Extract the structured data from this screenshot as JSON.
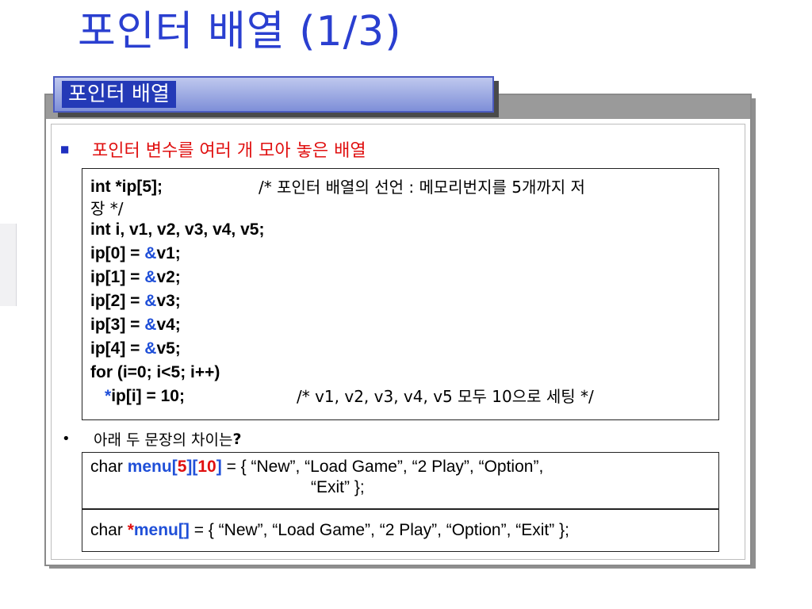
{
  "title": "포인터 배열 (1/3)",
  "header_tab": "포인터 배열",
  "bullet1": "포인터 변수를 여러 개 모아 놓은 배열",
  "bullet2": {
    "text": "아래 두 문장의 차이는",
    "q": "?"
  },
  "code": {
    "l1_code": "int *ip[5];",
    "l1_comment": "/* 포인터 배열의 선언 : 메모리번지를 5개까지 저",
    "l1_wrap": "장 */",
    "l2": "int i, v1, v2, v3, v4, v5;",
    "assign": [
      {
        "lhs": "ip[0] = ",
        "amp": "&",
        "rhs": "v1;"
      },
      {
        "lhs": "ip[1] = ",
        "amp": "&",
        "rhs": "v2;"
      },
      {
        "lhs": "ip[2] = ",
        "amp": "&",
        "rhs": "v3;"
      },
      {
        "lhs": "ip[3] = ",
        "amp": "&",
        "rhs": "v4;"
      },
      {
        "lhs": "ip[4] = ",
        "amp": "&",
        "rhs": "v5;"
      }
    ],
    "for_line": "for (i=0; i<5; i++)",
    "last_star": "*",
    "last_code": "ip[i] = 10;",
    "last_comment": "/* v1, v2, v3, v4, v5 모두 10으로 세팅 */"
  },
  "box2": {
    "pre": "char ",
    "name": "menu[",
    "n1": "5",
    "mid": "][",
    "n2": "10",
    "close": "]",
    "rest": " = { “New”, “Load Game”, “2 Play”, “Option”,",
    "wrap": "“Exit” };"
  },
  "box3": {
    "pre": "char ",
    "star": "*",
    "name": "menu[]",
    "rest": " = { “New”, “Load Game”, “2 Play”, “Option”, “Exit” };"
  },
  "colors": {
    "title": "#2a3fd0",
    "accent_blue": "#1f4fd8",
    "accent_red": "#e01010"
  }
}
